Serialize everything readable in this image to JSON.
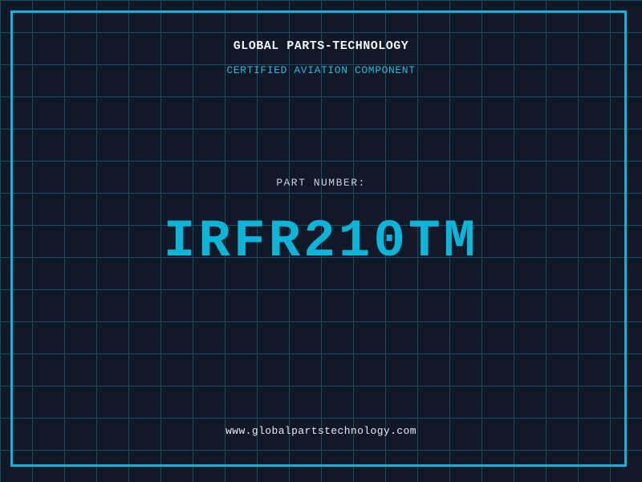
{
  "colors": {
    "background": "#111827",
    "grid_line": "#164d63",
    "frame": "#0db6d8",
    "accent_cyan": "#0cb4d8",
    "subtitle_cyan": "#29b8da",
    "title_text": "#f2f4f6",
    "label_text": "#c9ced6",
    "footer_text": "#e8eaee"
  },
  "header": {
    "company": "GLOBAL PARTS-TECHNOLOGY",
    "subtitle": "CERTIFIED AVIATION COMPONENT"
  },
  "part": {
    "label": "PART NUMBER:",
    "number": "IRFR210TM"
  },
  "footer": {
    "url": "www.globalpartstechnology.com"
  }
}
